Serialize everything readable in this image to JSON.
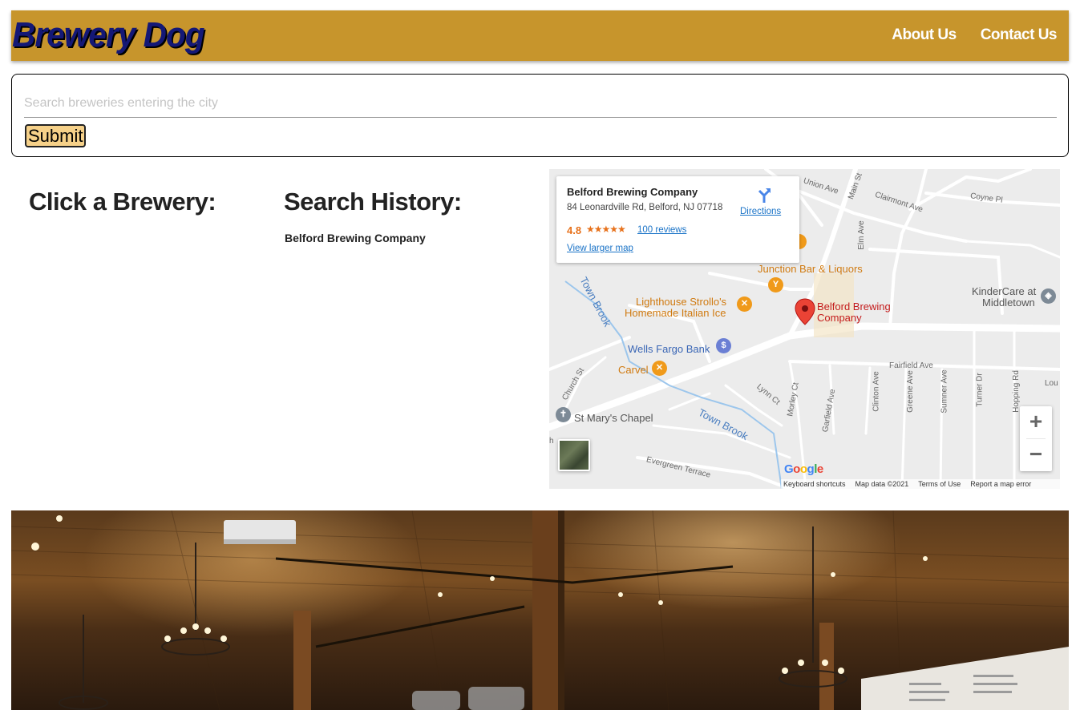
{
  "header": {
    "brand": "Brewery Dog",
    "nav": [
      {
        "label": "About Us"
      },
      {
        "label": "Contact Us"
      }
    ]
  },
  "search": {
    "placeholder": "Search breweries entering the city",
    "value": "",
    "submit_label": "Submit"
  },
  "brewery_list": {
    "heading": "Click a Brewery:"
  },
  "history": {
    "heading": "Search History:",
    "items": [
      "Belford Brewing Company"
    ]
  },
  "map": {
    "info_card": {
      "name": "Belford Brewing Company",
      "address": "84 Leonardville Rd, Belford, NJ 07718",
      "rating": "4.8",
      "stars": "★★★★★",
      "reviews": "100 reviews",
      "larger_map": "View larger map",
      "directions": "Directions"
    },
    "places": {
      "junction": "Junction Bar & Liquors",
      "lighthouse_1": "Lighthouse Strollo's",
      "lighthouse_2": "Homemade Italian Ice",
      "belford_1": "Belford Brewing",
      "belford_2": "Company",
      "wells": "Wells Fargo Bank",
      "carvel": "Carvel",
      "chapel": "St Mary's Chapel",
      "kinder_1": "KinderCare at",
      "kinder_2": "Middletown"
    },
    "streets": {
      "union": "Union Ave",
      "clairmont": "Clairmont Ave",
      "coyne": "Coyne Pl",
      "main": "Main St",
      "elm": "Elm Ave",
      "fairfield": "Fairfield Ave",
      "church": "Church St",
      "lynn": "Lynn Ct",
      "morley": "Morley Ct",
      "garfield": "Garfield Ave",
      "clinton": "Clinton Ave",
      "greene": "Greene Ave",
      "sumner": "Sumner Ave",
      "turner": "Turner Dr",
      "hopping": "Hopping Rd",
      "evergreen": "Evergreen Terrace",
      "lou": "Lou",
      "h": "h"
    },
    "water": {
      "brook_1": "Town Brook",
      "brook_2": "Town Brook"
    },
    "zoom_in": "+",
    "zoom_out": "−",
    "google": "Google",
    "footer": [
      "Keyboard shortcuts",
      "Map data ©2021",
      "Terms of Use",
      "Report a map error"
    ],
    "colors": {
      "marker": "#ea4335",
      "road": "#ffffff",
      "water": "#9cc6ec",
      "land": "#ececec"
    }
  },
  "colors": {
    "header_bg": "#c7952c",
    "brand_text": "#141876",
    "submit_bg": "#f6d189"
  }
}
